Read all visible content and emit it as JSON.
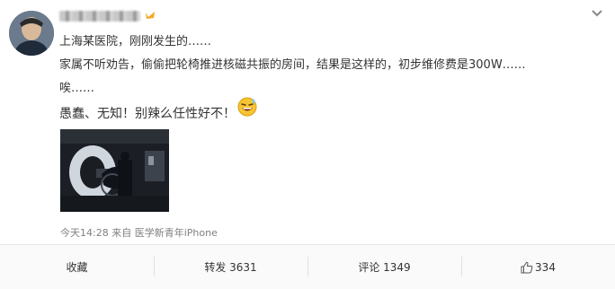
{
  "post": {
    "line1": "上海某医院，刚刚发生的……",
    "line2": "家属不听劝告，偷偷把轮椅推进核磁共振的房间，结果是这样的，初步维修费是300W……",
    "line3": "唉……",
    "line4": "愚蠢、无知！别辣么任性好不！",
    "emoji": "grin-sweat-emoji"
  },
  "meta": {
    "time": "今天14:28",
    "source_prefix": "来自",
    "source": "医学新青年iPhone"
  },
  "actions": {
    "favorite": "收藏",
    "repost": "转发 3631",
    "comment": "评论 1349",
    "like": "334"
  },
  "icons": {
    "expand": "chevron-down-icon",
    "verify": "verified-badge-icon",
    "like": "thumbs-up-icon"
  },
  "colors": {
    "accent": "#f5a623",
    "text": "#333333",
    "meta": "#808080"
  }
}
